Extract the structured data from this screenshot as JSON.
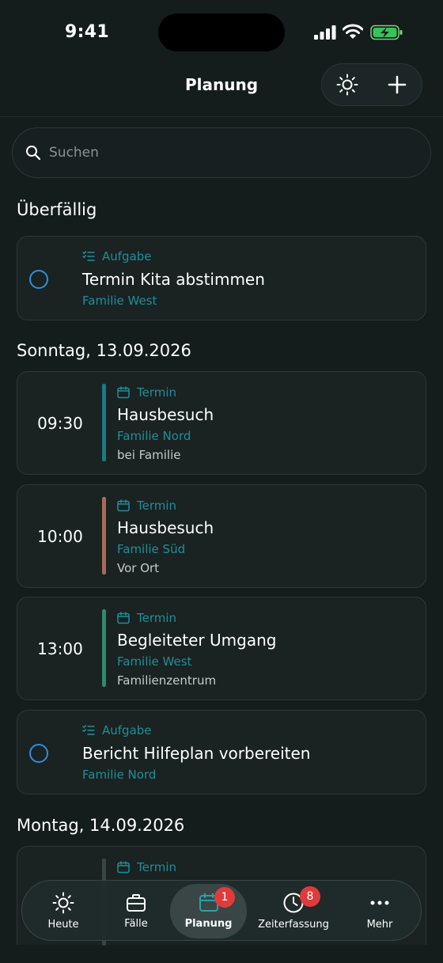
{
  "status": {
    "time": "9:41"
  },
  "header": {
    "title": "Planung",
    "icons": [
      "sun-icon",
      "plus-icon"
    ]
  },
  "search": {
    "placeholder": "Suchen"
  },
  "sections": [
    {
      "title": "Überfällig",
      "items": [
        {
          "kind": "task",
          "type": "Aufgabe",
          "title": "Termin Kita abstimmen",
          "client": "Familie West"
        }
      ]
    },
    {
      "title": "Sonntag, 13.09.2026",
      "items": [
        {
          "kind": "appointment",
          "time": "09:30",
          "type": "Termin",
          "title": "Hausbesuch",
          "client": "Familie Nord",
          "location": "bei Familie",
          "color": "#1b7a82"
        },
        {
          "kind": "appointment",
          "time": "10:00",
          "type": "Termin",
          "title": "Hausbesuch",
          "client": "Familie Süd",
          "location": "Vor Ort",
          "color": "#a56a5a"
        },
        {
          "kind": "appointment",
          "time": "13:00",
          "type": "Termin",
          "title": "Begleiteter Umgang",
          "client": "Familie West",
          "location": "Familienzentrum",
          "color": "#2e8a6a"
        },
        {
          "kind": "task",
          "type": "Aufgabe",
          "title": "Bericht Hilfeplan vorbereiten",
          "client": "Familie Nord"
        }
      ]
    },
    {
      "title": "Montag, 14.09.2026",
      "items": [
        {
          "kind": "appointment",
          "type": "Termin"
        }
      ]
    }
  ],
  "tabs": [
    {
      "label": "Heute",
      "icon": "sun-icon"
    },
    {
      "label": "Fälle",
      "icon": "briefcase-icon"
    },
    {
      "label": "Planung",
      "icon": "calendar-icon",
      "badge": "1",
      "active": true
    },
    {
      "label": "Zeiterfassung",
      "icon": "clock-icon",
      "badge": "8"
    },
    {
      "label": "Mehr",
      "icon": "more-icon"
    }
  ],
  "colors": {
    "accent": "#1f8f9a",
    "taskCircle": "#2e8fe0",
    "badge": "#e03b3b",
    "background": "#141c1c"
  }
}
